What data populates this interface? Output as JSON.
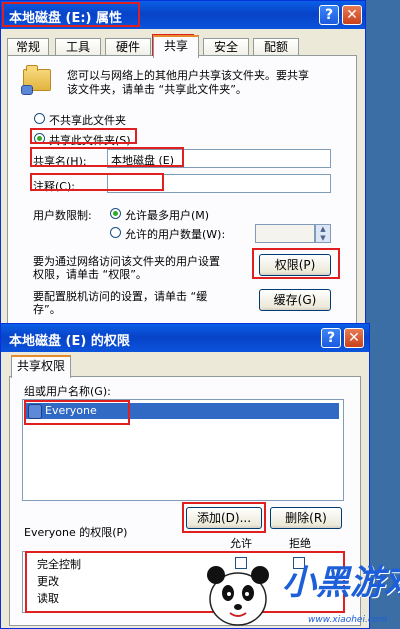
{
  "properties_window": {
    "title": "本地磁盘 (E:) 属性",
    "tabs": [
      "常规",
      "工具",
      "硬件",
      "共享",
      "安全",
      "配额"
    ],
    "active_tab": "共享",
    "description": [
      "您可以与网络上的其他用户共享该文件夹。要共享",
      "该文件夹，请单击 “共享此文件夹”。"
    ],
    "radio_no_share": "不共享此文件夹",
    "radio_share": "共享此文件夹(S)",
    "share_name_label": "共享名(H):",
    "share_name_value": "本地磁盘  (E)",
    "comment_label": "注释(C):",
    "comment_value": "",
    "user_limit_label": "用户数限制:",
    "limit_max": "允许最多用户(M)",
    "limit_count": "允许的用户数量(W):",
    "permissions_text": [
      "要为通过网络访问该文件夹的用户设置",
      "权限，请单击 “权限”。"
    ],
    "permissions_button": "权限(P)",
    "cache_text": [
      "要配置脱机访问的设置，请单击 “缓",
      "存”。"
    ],
    "cache_button": "缓存(G)"
  },
  "permissions_window": {
    "title": "本地磁盘 (E) 的权限",
    "tab": "共享权限",
    "group_label": "组或用户名称(G):",
    "users": [
      "Everyone"
    ],
    "add_button": "添加(D)...",
    "remove_button": "删除(R)",
    "perm_header": "Everyone 的权限(P)",
    "allow_label": "允许",
    "deny_label": "拒绝",
    "permissions": [
      "完全控制",
      "更改",
      "读取"
    ]
  },
  "watermark": {
    "brand": "小黑游戏",
    "url": "www.xiaohei.com"
  },
  "colors": {
    "titlebar": "#0843c8",
    "highlight": "#e02020",
    "selection": "#316ac5"
  }
}
